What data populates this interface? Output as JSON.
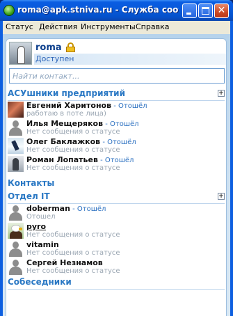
{
  "window": {
    "title": "roma@apk.stniva.ru - Служба сооб…",
    "min_label": "",
    "max_label": "",
    "close_label": "✕"
  },
  "menu": [
    "Статус",
    "Действия",
    "Инструменты",
    "Справка"
  ],
  "profile": {
    "name": "roma",
    "status": "Доступен"
  },
  "search": {
    "placeholder": "Найти контакт..."
  },
  "groups": {
    "g1": {
      "title": "АСУшники предприятий",
      "contacts": [
        {
          "name": "Евгений Харитонов",
          "sep": " - ",
          "status": "Отошёл",
          "sub": "работаю в поте лица)"
        },
        {
          "name": "Илья Мещеряков",
          "sep": " - ",
          "status": "Отошёл",
          "sub": "Нет сообщения о статусе"
        },
        {
          "name": "Олег Баклажков",
          "sep": " - ",
          "status": "Отошёл",
          "sub": "Нет сообщения о статусе"
        },
        {
          "name": "Роман Лопатьев",
          "sep": " - ",
          "status": "Отошёл",
          "sub": "Нет сообщения о статусе"
        }
      ]
    },
    "g2": {
      "title": "Контакты"
    },
    "g3": {
      "title": "Отдел IT",
      "contacts": [
        {
          "name": "doberman",
          "sep": " - ",
          "status": "Отошёл",
          "sub": "Отошел"
        },
        {
          "name": "pyro",
          "sub": "Нет сообщения о статусе"
        },
        {
          "name": "vitamin",
          "sub": "Нет сообщения о статусе"
        },
        {
          "name": "Сергей Незнамов",
          "sub": "Нет сообщения о статусе"
        }
      ]
    },
    "g4": {
      "title": "Собеседники"
    }
  },
  "expand_glyph": "+"
}
